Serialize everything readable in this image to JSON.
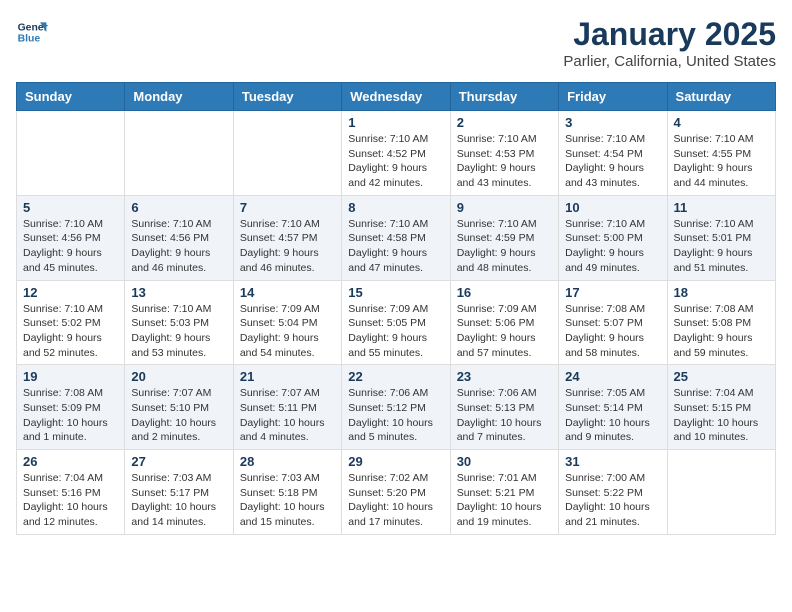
{
  "header": {
    "logo_line1": "General",
    "logo_line2": "Blue",
    "month": "January 2025",
    "location": "Parlier, California, United States"
  },
  "weekdays": [
    "Sunday",
    "Monday",
    "Tuesday",
    "Wednesday",
    "Thursday",
    "Friday",
    "Saturday"
  ],
  "weeks": [
    [
      {
        "day": "",
        "info": ""
      },
      {
        "day": "",
        "info": ""
      },
      {
        "day": "",
        "info": ""
      },
      {
        "day": "1",
        "info": "Sunrise: 7:10 AM\nSunset: 4:52 PM\nDaylight: 9 hours\nand 42 minutes."
      },
      {
        "day": "2",
        "info": "Sunrise: 7:10 AM\nSunset: 4:53 PM\nDaylight: 9 hours\nand 43 minutes."
      },
      {
        "day": "3",
        "info": "Sunrise: 7:10 AM\nSunset: 4:54 PM\nDaylight: 9 hours\nand 43 minutes."
      },
      {
        "day": "4",
        "info": "Sunrise: 7:10 AM\nSunset: 4:55 PM\nDaylight: 9 hours\nand 44 minutes."
      }
    ],
    [
      {
        "day": "5",
        "info": "Sunrise: 7:10 AM\nSunset: 4:56 PM\nDaylight: 9 hours\nand 45 minutes."
      },
      {
        "day": "6",
        "info": "Sunrise: 7:10 AM\nSunset: 4:56 PM\nDaylight: 9 hours\nand 46 minutes."
      },
      {
        "day": "7",
        "info": "Sunrise: 7:10 AM\nSunset: 4:57 PM\nDaylight: 9 hours\nand 46 minutes."
      },
      {
        "day": "8",
        "info": "Sunrise: 7:10 AM\nSunset: 4:58 PM\nDaylight: 9 hours\nand 47 minutes."
      },
      {
        "day": "9",
        "info": "Sunrise: 7:10 AM\nSunset: 4:59 PM\nDaylight: 9 hours\nand 48 minutes."
      },
      {
        "day": "10",
        "info": "Sunrise: 7:10 AM\nSunset: 5:00 PM\nDaylight: 9 hours\nand 49 minutes."
      },
      {
        "day": "11",
        "info": "Sunrise: 7:10 AM\nSunset: 5:01 PM\nDaylight: 9 hours\nand 51 minutes."
      }
    ],
    [
      {
        "day": "12",
        "info": "Sunrise: 7:10 AM\nSunset: 5:02 PM\nDaylight: 9 hours\nand 52 minutes."
      },
      {
        "day": "13",
        "info": "Sunrise: 7:10 AM\nSunset: 5:03 PM\nDaylight: 9 hours\nand 53 minutes."
      },
      {
        "day": "14",
        "info": "Sunrise: 7:09 AM\nSunset: 5:04 PM\nDaylight: 9 hours\nand 54 minutes."
      },
      {
        "day": "15",
        "info": "Sunrise: 7:09 AM\nSunset: 5:05 PM\nDaylight: 9 hours\nand 55 minutes."
      },
      {
        "day": "16",
        "info": "Sunrise: 7:09 AM\nSunset: 5:06 PM\nDaylight: 9 hours\nand 57 minutes."
      },
      {
        "day": "17",
        "info": "Sunrise: 7:08 AM\nSunset: 5:07 PM\nDaylight: 9 hours\nand 58 minutes."
      },
      {
        "day": "18",
        "info": "Sunrise: 7:08 AM\nSunset: 5:08 PM\nDaylight: 9 hours\nand 59 minutes."
      }
    ],
    [
      {
        "day": "19",
        "info": "Sunrise: 7:08 AM\nSunset: 5:09 PM\nDaylight: 10 hours\nand 1 minute."
      },
      {
        "day": "20",
        "info": "Sunrise: 7:07 AM\nSunset: 5:10 PM\nDaylight: 10 hours\nand 2 minutes."
      },
      {
        "day": "21",
        "info": "Sunrise: 7:07 AM\nSunset: 5:11 PM\nDaylight: 10 hours\nand 4 minutes."
      },
      {
        "day": "22",
        "info": "Sunrise: 7:06 AM\nSunset: 5:12 PM\nDaylight: 10 hours\nand 5 minutes."
      },
      {
        "day": "23",
        "info": "Sunrise: 7:06 AM\nSunset: 5:13 PM\nDaylight: 10 hours\nand 7 minutes."
      },
      {
        "day": "24",
        "info": "Sunrise: 7:05 AM\nSunset: 5:14 PM\nDaylight: 10 hours\nand 9 minutes."
      },
      {
        "day": "25",
        "info": "Sunrise: 7:04 AM\nSunset: 5:15 PM\nDaylight: 10 hours\nand 10 minutes."
      }
    ],
    [
      {
        "day": "26",
        "info": "Sunrise: 7:04 AM\nSunset: 5:16 PM\nDaylight: 10 hours\nand 12 minutes."
      },
      {
        "day": "27",
        "info": "Sunrise: 7:03 AM\nSunset: 5:17 PM\nDaylight: 10 hours\nand 14 minutes."
      },
      {
        "day": "28",
        "info": "Sunrise: 7:03 AM\nSunset: 5:18 PM\nDaylight: 10 hours\nand 15 minutes."
      },
      {
        "day": "29",
        "info": "Sunrise: 7:02 AM\nSunset: 5:20 PM\nDaylight: 10 hours\nand 17 minutes."
      },
      {
        "day": "30",
        "info": "Sunrise: 7:01 AM\nSunset: 5:21 PM\nDaylight: 10 hours\nand 19 minutes."
      },
      {
        "day": "31",
        "info": "Sunrise: 7:00 AM\nSunset: 5:22 PM\nDaylight: 10 hours\nand 21 minutes."
      },
      {
        "day": "",
        "info": ""
      }
    ]
  ]
}
